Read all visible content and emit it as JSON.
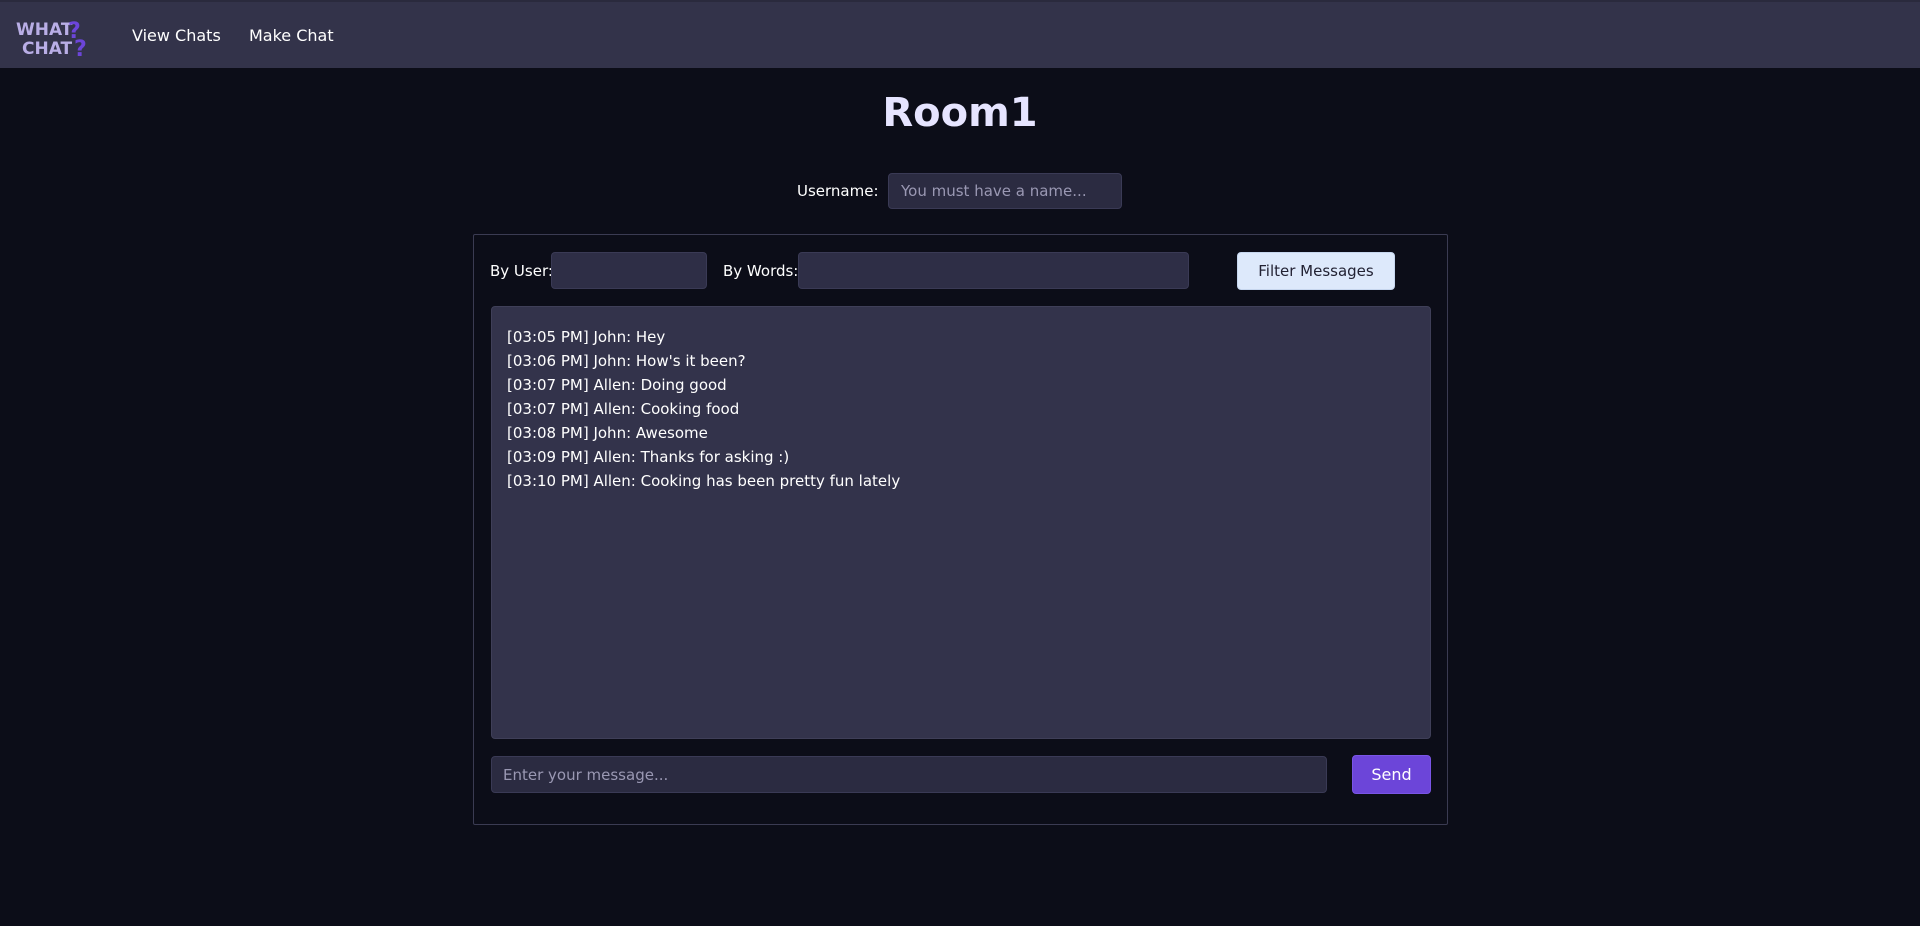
{
  "app": {
    "logo_line1": "WHAT",
    "logo_line2": "CHAT",
    "brand_color": "#6c45d9"
  },
  "nav": {
    "view_chats": "View Chats",
    "make_chat": "Make Chat"
  },
  "room": {
    "title": "Room1"
  },
  "username": {
    "label": "Username:",
    "placeholder": "You must have a name...",
    "value": ""
  },
  "filter": {
    "by_user_label": "By User:",
    "by_user_value": "",
    "by_words_label": "By Words:",
    "by_words_value": "",
    "button_label": "Filter Messages"
  },
  "messages": [
    "[03:05 PM] John: Hey",
    "[03:06 PM] John: How's it been?",
    "[03:07 PM] Allen: Doing good",
    "[03:07 PM] Allen: Cooking food",
    "[03:08 PM] John: Awesome",
    "[03:09 PM] Allen: Thanks for asking :)",
    "[03:10 PM] Allen: Cooking has been pretty fun lately"
  ],
  "composer": {
    "placeholder": "Enter your message...",
    "value": "",
    "send_label": "Send"
  }
}
